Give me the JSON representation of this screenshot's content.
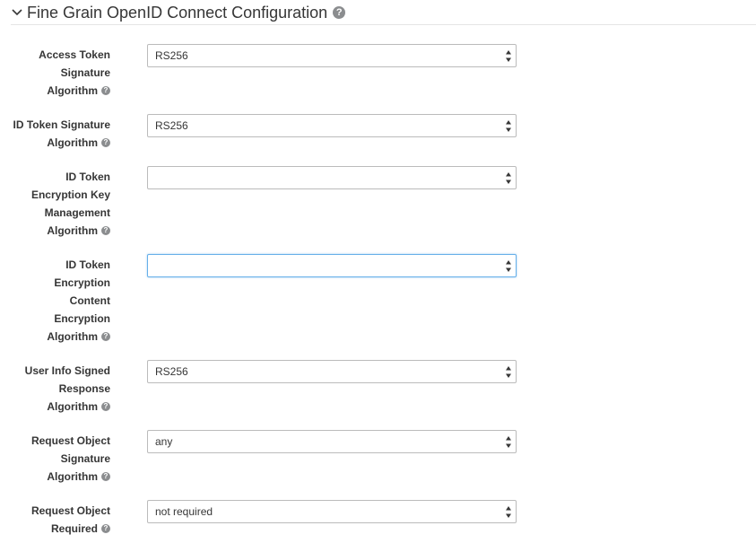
{
  "section": {
    "title": "Fine Grain OpenID Connect Configuration",
    "expanded": true,
    "icons": {
      "toggle": "chevron-down-icon",
      "help": "question-circle-icon"
    }
  },
  "fields": [
    {
      "label_lines": [
        "Access Token",
        "Signature",
        "Algorithm"
      ],
      "value": "RS256"
    },
    {
      "label_lines": [
        "ID Token Signature",
        "Algorithm"
      ],
      "value": "RS256"
    },
    {
      "label_lines": [
        "ID Token",
        "Encryption Key",
        "Management",
        "Algorithm"
      ],
      "value": ""
    },
    {
      "label_lines": [
        "ID Token",
        "Encryption",
        "Content",
        "Encryption",
        "Algorithm"
      ],
      "value": "",
      "focused": true
    },
    {
      "label_lines": [
        "User Info Signed",
        "Response",
        "Algorithm"
      ],
      "value": "RS256"
    },
    {
      "label_lines": [
        "Request Object",
        "Signature",
        "Algorithm"
      ],
      "value": "any"
    },
    {
      "label_lines": [
        "Request Object",
        "Required"
      ],
      "value": "not required"
    }
  ],
  "colors": {
    "text": "#363636",
    "help_icon": "#8b8d8f",
    "border": "#bbbbbb",
    "focus_border": "#66afe9"
  }
}
